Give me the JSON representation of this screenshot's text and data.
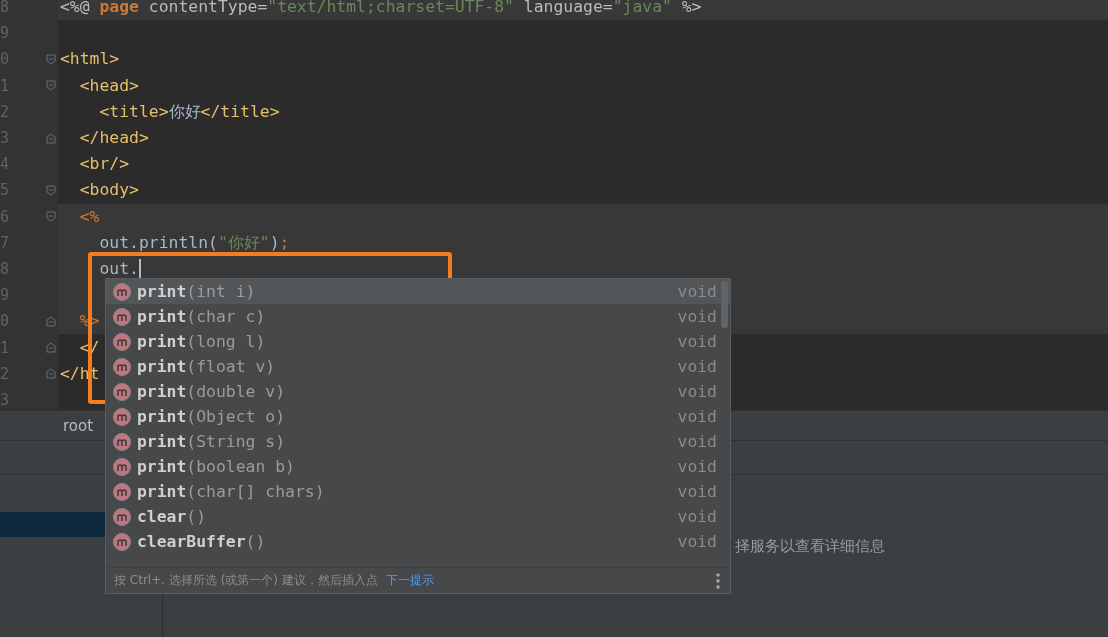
{
  "editor": {
    "lines": [
      {
        "number": "8",
        "kind": "plain",
        "highlight": true,
        "tokens": [
          {
            "kind": "directive",
            "text": "<%@ "
          },
          {
            "kind": "keyword",
            "text": "page"
          },
          {
            "kind": "attr",
            "text": " contentType="
          },
          {
            "kind": "string",
            "text": "\"text/html;charset=UTF-8\""
          },
          {
            "kind": "attr",
            "text": " language="
          },
          {
            "kind": "string",
            "text": "\"java\""
          },
          {
            "kind": "directive",
            "text": " %>"
          }
        ]
      },
      {
        "number": "9",
        "kind": "plain"
      },
      {
        "number": "0",
        "kind": "opener",
        "tokens": [
          {
            "kind": "tag",
            "text": "<html>"
          }
        ]
      },
      {
        "number": "1",
        "kind": "opener",
        "tokens": [
          {
            "kind": "tag",
            "text": "  <head>"
          }
        ]
      },
      {
        "number": "2",
        "kind": "plain",
        "tokens": [
          {
            "kind": "tag",
            "text": "    <title>"
          },
          {
            "kind": "text",
            "text": "你好"
          },
          {
            "kind": "tag",
            "text": "</title>"
          }
        ]
      },
      {
        "number": "3",
        "kind": "closer",
        "tokens": [
          {
            "kind": "tag",
            "text": "  </head>"
          }
        ]
      },
      {
        "number": "4",
        "kind": "plain",
        "tokens": [
          {
            "kind": "tag",
            "text": "  <br/>"
          }
        ]
      },
      {
        "number": "5",
        "kind": "opener",
        "tokens": [
          {
            "kind": "tag",
            "text": "  <body>"
          }
        ]
      },
      {
        "number": "6",
        "kind": "opener",
        "highlight": true,
        "tokens": [
          {
            "kind": "keyword",
            "text": "  <%"
          }
        ]
      },
      {
        "number": "7",
        "kind": "plain",
        "highlight": true,
        "tokens": [
          {
            "kind": "text",
            "text": "    out.println("
          },
          {
            "kind": "string",
            "text": "\"你好\""
          },
          {
            "kind": "text",
            "text": ")"
          },
          {
            "kind": "punct",
            "text": ";"
          }
        ]
      },
      {
        "number": "8",
        "kind": "plain",
        "highlight": true,
        "caret": true,
        "tokens": [
          {
            "kind": "text",
            "text": "    out."
          }
        ]
      },
      {
        "number": "9",
        "kind": "plain",
        "highlight": true
      },
      {
        "number": "0",
        "kind": "closer",
        "highlight": true,
        "tokens": [
          {
            "kind": "keyword",
            "text": "  %>"
          }
        ]
      },
      {
        "number": "1",
        "kind": "closer",
        "tokens": [
          {
            "kind": "tag",
            "text": "  </"
          }
        ]
      },
      {
        "number": "2",
        "kind": "closer",
        "tokens": [
          {
            "kind": "tag",
            "text": "</ht"
          }
        ]
      },
      {
        "number": "3",
        "kind": "plain"
      }
    ]
  },
  "breadcrumb": "root",
  "services": {
    "message": "择服务以查看详细信息",
    "rows": [
      {
        "selected": true
      }
    ]
  },
  "completion": {
    "items": [
      {
        "name": "print",
        "params": "(int i)",
        "type": "void",
        "selected": true
      },
      {
        "name": "print",
        "params": "(char c)",
        "type": "void",
        "selected": false
      },
      {
        "name": "print",
        "params": "(long l)",
        "type": "void",
        "selected": false
      },
      {
        "name": "print",
        "params": "(float v)",
        "type": "void",
        "selected": false
      },
      {
        "name": "print",
        "params": "(double v)",
        "type": "void",
        "selected": false
      },
      {
        "name": "print",
        "params": "(Object o)",
        "type": "void",
        "selected": false
      },
      {
        "name": "print",
        "params": "(String s)",
        "type": "void",
        "selected": false
      },
      {
        "name": "print",
        "params": "(boolean b)",
        "type": "void",
        "selected": false
      },
      {
        "name": "print",
        "params": "(char[] chars)",
        "type": "void",
        "selected": false
      },
      {
        "name": "clear",
        "params": "()",
        "type": "void",
        "selected": false
      },
      {
        "name": "clearBuffer",
        "params": "()",
        "type": "void",
        "selected": false
      }
    ],
    "hint": "按 Ctrl+. 选择所选 (或第一个) 建议，然后插入点",
    "hint_link": "下一提示"
  }
}
